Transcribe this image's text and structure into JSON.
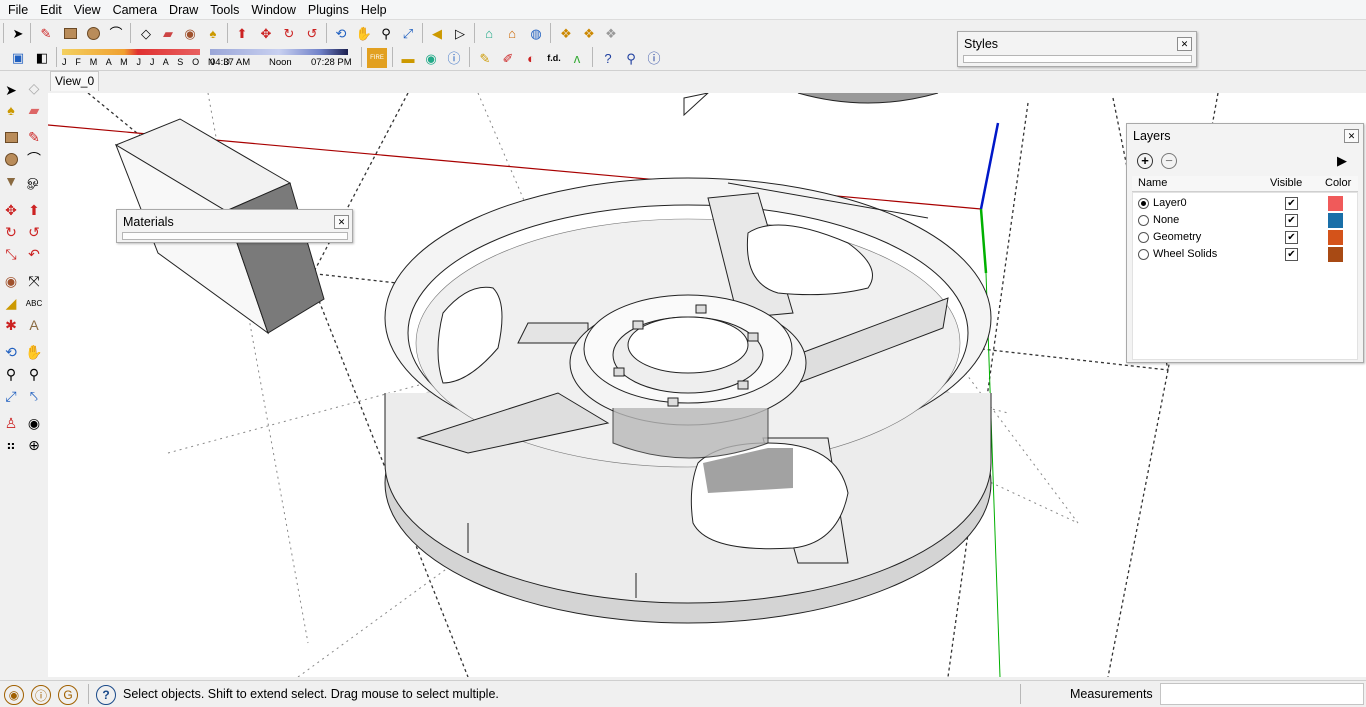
{
  "menu": [
    "File",
    "Edit",
    "View",
    "Camera",
    "Draw",
    "Tools",
    "Window",
    "Plugins",
    "Help"
  ],
  "toolbar_icons": [
    "select-icon",
    "pencil-icon",
    "rectangle-icon",
    "circle-icon",
    "arc-icon",
    "eraser-icon",
    "push-pull-icon",
    "offset-icon",
    "move-icon",
    "rotate-icon",
    "scale-icon",
    "orbit-icon",
    "pan-icon",
    "zoom-icon",
    "zoom-extents-icon"
  ],
  "shadows": {
    "months": "J F M A M J J A S O N D",
    "sunrise": "04:37 AM",
    "noon": "Noon",
    "sunset": "07:28 PM"
  },
  "scene_tab": "View_0",
  "styles_panel": {
    "title": "Styles"
  },
  "materials_panel": {
    "title": "Materials"
  },
  "layers_panel": {
    "title": "Layers",
    "columns": {
      "name": "Name",
      "visible": "Visible",
      "color": "Color"
    },
    "layers": [
      {
        "name": "Layer0",
        "active": true,
        "visible": true,
        "color": "#f05a5a"
      },
      {
        "name": "None",
        "active": false,
        "visible": true,
        "color": "#1a6fa8"
      },
      {
        "name": "Geometry",
        "active": false,
        "visible": true,
        "color": "#d4531a"
      },
      {
        "name": "Wheel Solids",
        "active": false,
        "visible": true,
        "color": "#a84a14"
      }
    ]
  },
  "status": {
    "message": "Select objects. Shift to extend select. Drag mouse to select multiple.",
    "measurements_label": "Measurements",
    "measurements_value": ""
  },
  "axis_colors": {
    "red": "#a80000",
    "green": "#00b000",
    "blue": "#0018c8"
  }
}
